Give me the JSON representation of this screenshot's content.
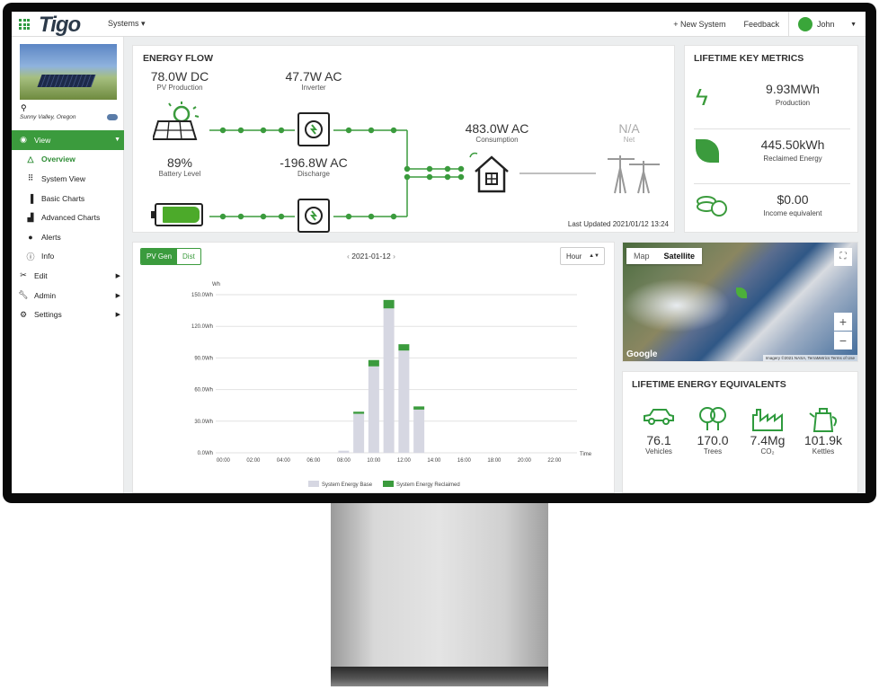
{
  "topbar": {
    "brand_main": "Tigo",
    "systems_label": "Systems",
    "new_system_label": "+ New System",
    "feedback_label": "Feedback",
    "user_name": "John"
  },
  "sidebar": {
    "location": "Sunny Valley, Oregon",
    "items": [
      {
        "label": "View",
        "icon": "eye-icon"
      },
      {
        "label": "Overview",
        "icon": "triangle-icon"
      },
      {
        "label": "System View",
        "icon": "grid-icon"
      },
      {
        "label": "Basic Charts",
        "icon": "bar-chart-icon"
      },
      {
        "label": "Advanced Charts",
        "icon": "advanced-chart-icon"
      },
      {
        "label": "Alerts",
        "icon": "alert-icon"
      },
      {
        "label": "Info",
        "icon": "info-icon"
      },
      {
        "label": "Edit",
        "icon": "tools-icon"
      },
      {
        "label": "Admin",
        "icon": "wrench-icon"
      },
      {
        "label": "Settings",
        "icon": "gear-icon"
      }
    ]
  },
  "energy_flow": {
    "title": "ENERGY FLOW",
    "pv_value": "78.0W DC",
    "pv_label": "PV Production",
    "inverter_value": "47.7W AC",
    "inverter_label": "Inverter",
    "battery_value": "89%",
    "battery_label": "Battery Level",
    "battery_fill": 0.89,
    "discharge_value": "-196.8W AC",
    "discharge_label": "Discharge",
    "consumption_value": "483.0W AC",
    "consumption_label": "Consumption",
    "net_value": "N/A",
    "net_label": "Net",
    "last_updated": "Last Updated 2021/01/12 13:24"
  },
  "lifetime_metrics": {
    "title": "LIFETIME KEY METRICS",
    "items": [
      {
        "value": "9.93MWh",
        "label": "Production",
        "icon": "bolt-icon"
      },
      {
        "value": "445.50kWh",
        "label": "Reclaimed Energy",
        "icon": "leaf-icon"
      },
      {
        "value": "$0.00",
        "label": "Income equivalent",
        "icon": "coins-icon"
      }
    ]
  },
  "chart_panel": {
    "toggle_pvgen": "PV Gen",
    "toggle_dist": "Dist",
    "date": "2021-01-12",
    "prev": "‹",
    "next": "›",
    "granularity": "Hour"
  },
  "chart_data": {
    "type": "bar",
    "ylabel": "Wh",
    "xlabel": "Time",
    "ylim": [
      0,
      150
    ],
    "yticks": [
      "0.0Wh",
      "30.0Wh",
      "60.0Wh",
      "90.0Wh",
      "120.0Wh",
      "150.0Wh"
    ],
    "xticks": [
      "00:00",
      "02:00",
      "04:00",
      "06:00",
      "08:00",
      "10:00",
      "12:00",
      "14:00",
      "16:00",
      "18:00",
      "20:00",
      "22:00"
    ],
    "categories": [
      "08:00",
      "09:00",
      "10:00",
      "11:00",
      "12:00",
      "13:00"
    ],
    "series": [
      {
        "name": "System Energy Base",
        "color": "#d6d7e2",
        "values": [
          2,
          37,
          82,
          137,
          97,
          41
        ]
      },
      {
        "name": "System Energy Reclaimed",
        "color": "#3b9b3d",
        "values": [
          0,
          2,
          6,
          8,
          6,
          3
        ]
      }
    ]
  },
  "map": {
    "tab_map": "Map",
    "tab_satellite": "Satellite",
    "attribution": "Imagery ©2021 NASA, TerraMetrics",
    "terms": "Terms of Use",
    "google": "Google",
    "zoom_in": "+",
    "zoom_out": "−"
  },
  "equivalents": {
    "title": "LIFETIME ENERGY EQUIVALENTS",
    "items": [
      {
        "value": "76.1",
        "label": "Vehicles",
        "icon": "car-icon"
      },
      {
        "value": "170.0",
        "label": "Trees",
        "icon": "trees-icon"
      },
      {
        "value": "7.4Mg",
        "label": "CO₂",
        "icon": "factory-icon"
      },
      {
        "value": "101.9k",
        "label": "Kettles",
        "icon": "kettle-icon"
      }
    ]
  }
}
